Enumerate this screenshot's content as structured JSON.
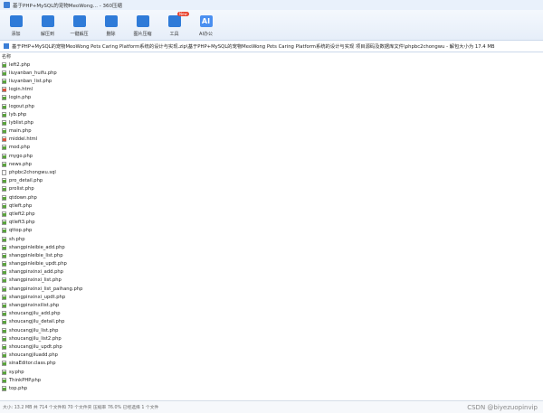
{
  "window": {
    "title": "基于PHP+MySQL的宠物MeoWong... - 360压缩"
  },
  "toolbar": {
    "items": [
      {
        "label": "添加",
        "icon": "add-icon",
        "color": "#2f7bd8"
      },
      {
        "label": "解压到",
        "icon": "extract-to-icon",
        "color": "#2f7bd8"
      },
      {
        "label": "一键解压",
        "icon": "one-click-extract-icon",
        "color": "#2f7bd8"
      },
      {
        "label": "删除",
        "icon": "delete-icon",
        "color": "#2f7bd8"
      },
      {
        "label": "图片压缩",
        "icon": "image-compress-icon",
        "color": "#2f7bd8"
      },
      {
        "label": "工具",
        "icon": "tools-icon",
        "color": "#2f7bd8",
        "badge": "New"
      },
      {
        "label": "AI办公",
        "icon": "ai-office-icon",
        "color": "#4a8ff0",
        "glyph": "AI"
      }
    ]
  },
  "pathbar": {
    "text": "基于PHP+MySQL的宠物MeoWong Pets Caring Platform系统的设计与实现.zip\\基于PHP+MySQL的宠物MeoWong Pets Caring Platform系统的设计与实现 项目源码及数据库文件\\phpbc2chongwu - 解包大小为 17.4 MB"
  },
  "list_header": {
    "name_col": "名称"
  },
  "files": [
    {
      "name": "left2.php",
      "type": "php"
    },
    {
      "name": "liuyanban_huifu.php",
      "type": "php"
    },
    {
      "name": "liuyanban_list.php",
      "type": "php"
    },
    {
      "name": "login.html",
      "type": "html"
    },
    {
      "name": "login.php",
      "type": "php"
    },
    {
      "name": "logout.php",
      "type": "php"
    },
    {
      "name": "lyb.php",
      "type": "php"
    },
    {
      "name": "lyblist.php",
      "type": "php"
    },
    {
      "name": "main.php",
      "type": "php"
    },
    {
      "name": "middel.html",
      "type": "html"
    },
    {
      "name": "mod.php",
      "type": "php"
    },
    {
      "name": "mygo.php",
      "type": "php"
    },
    {
      "name": "news.php",
      "type": "php"
    },
    {
      "name": "phpbc2chongwu.sql",
      "type": "sql"
    },
    {
      "name": "pro_detail.php",
      "type": "php"
    },
    {
      "name": "prolist.php",
      "type": "php"
    },
    {
      "name": "qtdown.php",
      "type": "php"
    },
    {
      "name": "qtleft.php",
      "type": "php"
    },
    {
      "name": "qtleft2.php",
      "type": "php"
    },
    {
      "name": "qtleft3.php",
      "type": "php"
    },
    {
      "name": "qttop.php",
      "type": "php"
    },
    {
      "name": "sh.php",
      "type": "php"
    },
    {
      "name": "shangpinleibie_add.php",
      "type": "php"
    },
    {
      "name": "shangpinleibie_list.php",
      "type": "php"
    },
    {
      "name": "shangpinleibie_updt.php",
      "type": "php"
    },
    {
      "name": "shangpinxinxi_add.php",
      "type": "php"
    },
    {
      "name": "shangpinxinxi_list.php",
      "type": "php"
    },
    {
      "name": "shangpinxinxi_list_paihang.php",
      "type": "php"
    },
    {
      "name": "shangpinxinxi_updt.php",
      "type": "php"
    },
    {
      "name": "shangpinxinxilist.php",
      "type": "php"
    },
    {
      "name": "shoucangjilu_add.php",
      "type": "php"
    },
    {
      "name": "shoucangjilu_detail.php",
      "type": "php"
    },
    {
      "name": "shoucangjilu_list.php",
      "type": "php"
    },
    {
      "name": "shoucangjilu_list2.php",
      "type": "php"
    },
    {
      "name": "shoucangjilu_updt.php",
      "type": "php"
    },
    {
      "name": "shoucangjiluadd.php",
      "type": "php"
    },
    {
      "name": "sinaEditor.class.php",
      "type": "php"
    },
    {
      "name": "sy.php",
      "type": "php"
    },
    {
      "name": "ThinkPHP.php",
      "type": "php"
    },
    {
      "name": "top.php",
      "type": "php"
    }
  ],
  "status": {
    "text": "大小: 13.2 MB 共 714 个文件和 70 个文件夹 压缩率 76.0% 已经选择 1 个文件",
    "watermark": "CSDN @biyezuopinvip"
  }
}
